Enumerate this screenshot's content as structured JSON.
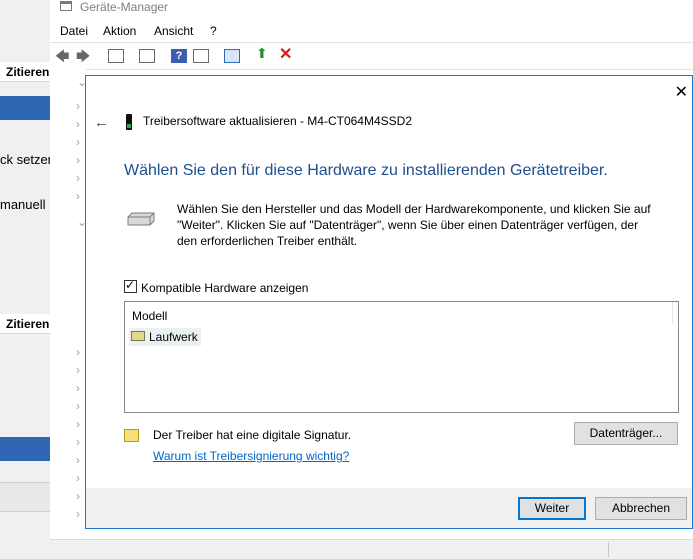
{
  "window": {
    "title": "Geräte-Manager"
  },
  "menu": [
    "Datei",
    "Aktion",
    "Ansicht",
    "?"
  ],
  "background": {
    "header_labels": [
      "Zitieren",
      "Zitieren"
    ],
    "fragments": [
      "ck setzen",
      "manuell"
    ]
  },
  "dialog": {
    "title": "Treibersoftware aktualisieren - M4-CT064M4SSD2",
    "heading": "Wählen Sie den für diese Hardware zu installierenden Gerätetreiber.",
    "description": "Wählen Sie den Hersteller und das Modell der Hardwarekomponente, und klicken Sie auf \"Weiter\". Klicken Sie auf \"Datenträger\", wenn Sie über einen Datenträger verfügen, der den erforderlichen Treiber enthält.",
    "checkbox_label": "Kompatible Hardware anzeigen",
    "checkbox_checked": true,
    "list_header": "Modell",
    "list_items": [
      "Laufwerk"
    ],
    "signature_text": "Der Treiber hat eine digitale Signatur.",
    "signature_link": "Warum ist Treibersignierung wichtig?",
    "disk_button": "Datenträger...",
    "next_button": "Weiter",
    "cancel_button": "Abbrechen"
  },
  "colors": {
    "accent": "#1d79c8",
    "heading": "#1f4e8c",
    "link": "#0066cc",
    "selection": "#3067b4"
  }
}
